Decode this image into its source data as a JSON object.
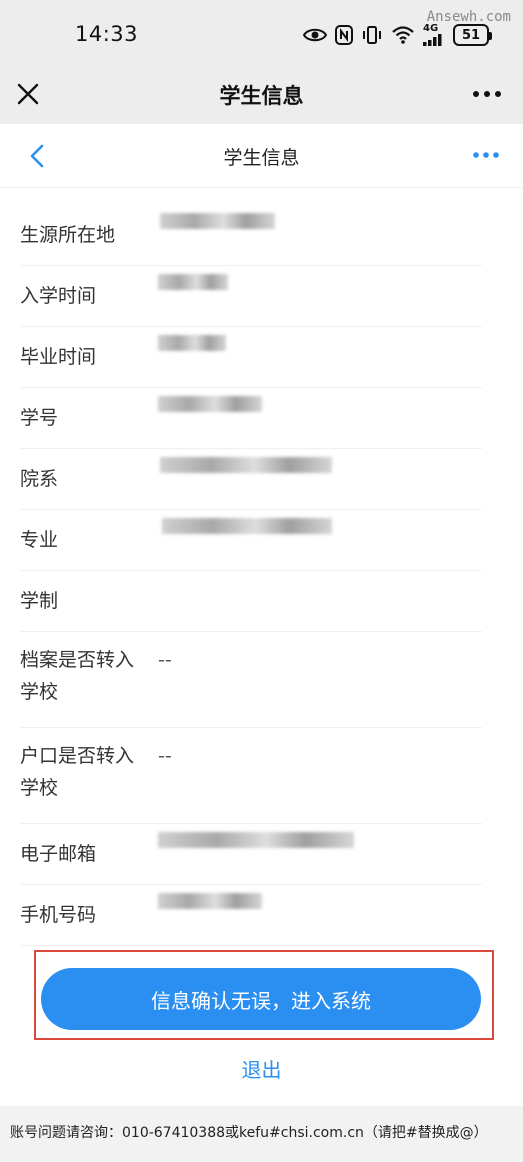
{
  "status_bar": {
    "time": "14:33",
    "network": "4G",
    "battery": "51",
    "watermark": "Ansewh.com"
  },
  "title_bar": {
    "title": "学生信息"
  },
  "nav_bar": {
    "title": "学生信息"
  },
  "info_rows": [
    {
      "label": "生源所在地",
      "value": ""
    },
    {
      "label": "入学时间",
      "value": ""
    },
    {
      "label": "毕业时间",
      "value": ""
    },
    {
      "label": "学号",
      "value": ""
    },
    {
      "label": "院系",
      "value": ""
    },
    {
      "label": "专业",
      "value": ""
    },
    {
      "label": "学制",
      "value": ""
    },
    {
      "label": "档案是否转入学校",
      "value": "--"
    },
    {
      "label": "户口是否转入学校",
      "value": "--"
    },
    {
      "label": "电子邮箱",
      "value": ""
    },
    {
      "label": "手机号码",
      "value": ""
    }
  ],
  "actions": {
    "confirm_label": "信息确认无误，进入系统",
    "exit_label": "退出"
  },
  "footer": {
    "text": "账号问题请咨询：010-67410388或kefu#chsi.com.cn（请把#替换成@）"
  },
  "colors": {
    "accent": "#2b8ff2",
    "highlight_border": "#d94a3a"
  }
}
